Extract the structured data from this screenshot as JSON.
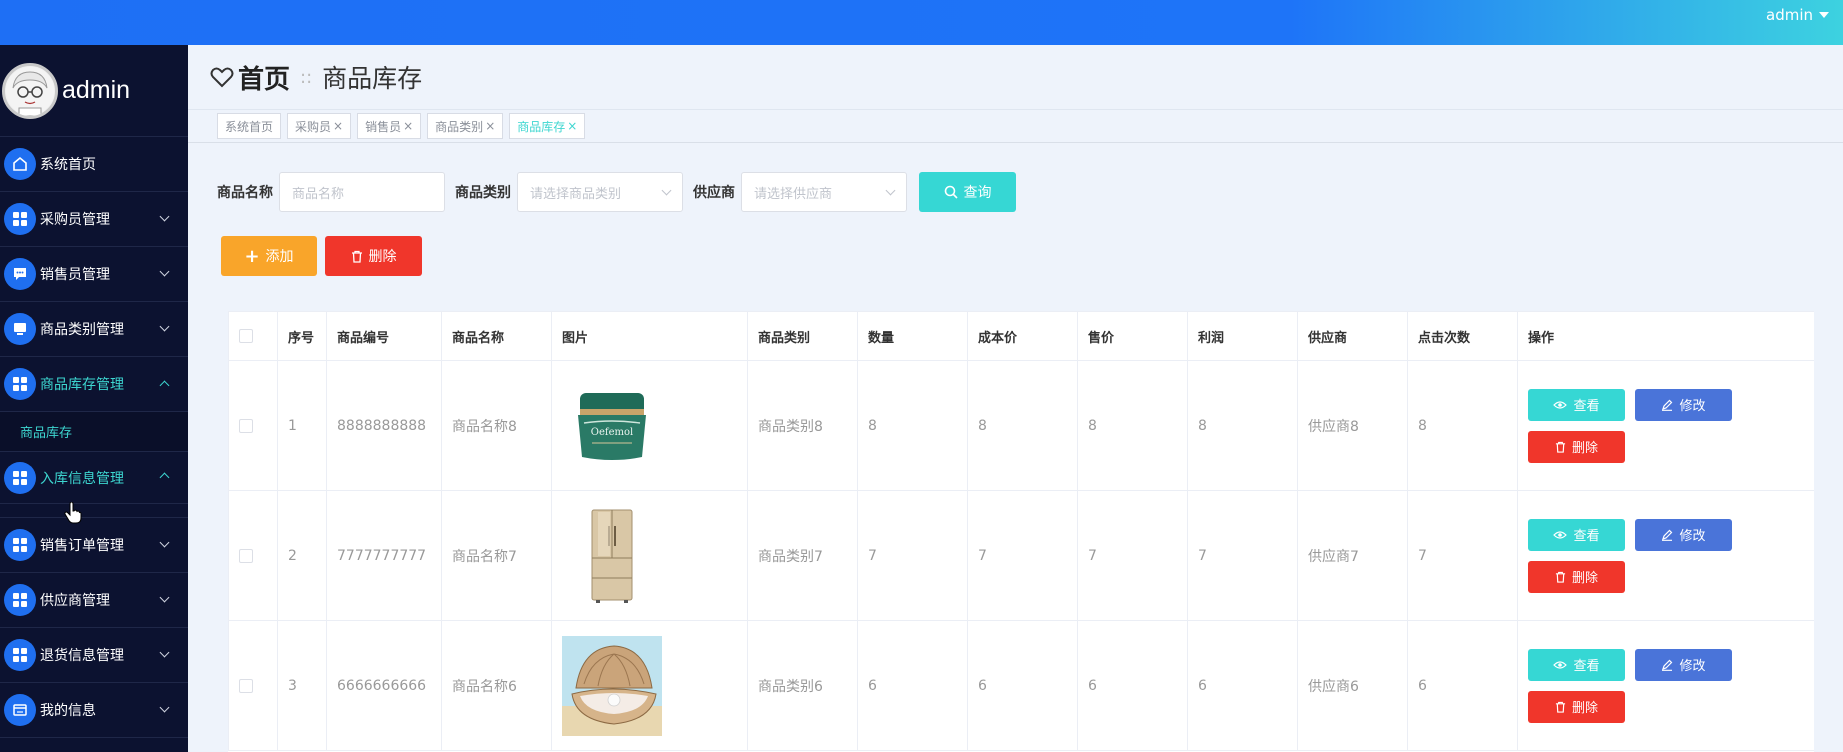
{
  "topbar": {
    "user": "admin"
  },
  "sidebar": {
    "brand": "admin",
    "items": [
      {
        "label": "系统首页",
        "icon": "home-icon",
        "chevron": false
      },
      {
        "label": "采购员管理",
        "icon": "grid-icon",
        "chevron": true
      },
      {
        "label": "销售员管理",
        "icon": "chat-icon",
        "chevron": true
      },
      {
        "label": "商品类别管理",
        "icon": "monitor-icon",
        "chevron": true
      },
      {
        "label": "商品库存管理",
        "icon": "grid-icon",
        "chevron": true,
        "active": true
      },
      {
        "label": "入库信息管理",
        "icon": "grid-icon",
        "chevron": true
      }
    ],
    "submenu": {
      "label": "商品库存"
    },
    "items2": [
      {
        "label": "销售订单管理",
        "icon": "grid-icon"
      },
      {
        "label": "供应商管理",
        "icon": "grid-icon"
      },
      {
        "label": "退货信息管理",
        "icon": "grid-icon"
      },
      {
        "label": "我的信息",
        "icon": "card-icon"
      }
    ]
  },
  "header": {
    "home": "首页",
    "separator": "::",
    "page": "商品库存"
  },
  "tags": [
    "系统首页",
    "采购员",
    "销售员",
    "商品类别",
    "商品库存"
  ],
  "search": {
    "name_label": "商品名称",
    "name_placeholder": "商品名称",
    "category_label": "商品类别",
    "category_placeholder": "请选择商品类别",
    "supplier_label": "供应商",
    "supplier_placeholder": "请选择供应商",
    "query_label": "查询"
  },
  "actions": {
    "add": "添加",
    "delete": "删除"
  },
  "table": {
    "headers": [
      "序号",
      "商品编号",
      "商品名称",
      "图片",
      "商品类别",
      "数量",
      "成本价",
      "售价",
      "利润",
      "供应商",
      "点击次数",
      "操作"
    ],
    "rows": [
      {
        "idx": "1",
        "code": "8888888888",
        "name": "商品名称8",
        "image": "cosmetic-jar-image",
        "category": "商品类别8",
        "qty": "8",
        "cost": "8",
        "price": "8",
        "profit": "8",
        "supplier": "供应商8",
        "clicks": "8"
      },
      {
        "idx": "2",
        "code": "7777777777",
        "name": "商品名称7",
        "image": "refrigerator-image",
        "category": "商品类别7",
        "qty": "7",
        "cost": "7",
        "price": "7",
        "profit": "7",
        "supplier": "供应商7",
        "clicks": "7"
      },
      {
        "idx": "3",
        "code": "6666666666",
        "name": "商品名称6",
        "image": "pearl-shell-image",
        "category": "商品类别6",
        "qty": "6",
        "cost": "6",
        "price": "6",
        "profit": "6",
        "supplier": "供应商6",
        "clicks": "6"
      }
    ],
    "op_view": "查看",
    "op_edit": "修改",
    "op_delete": "删除"
  }
}
